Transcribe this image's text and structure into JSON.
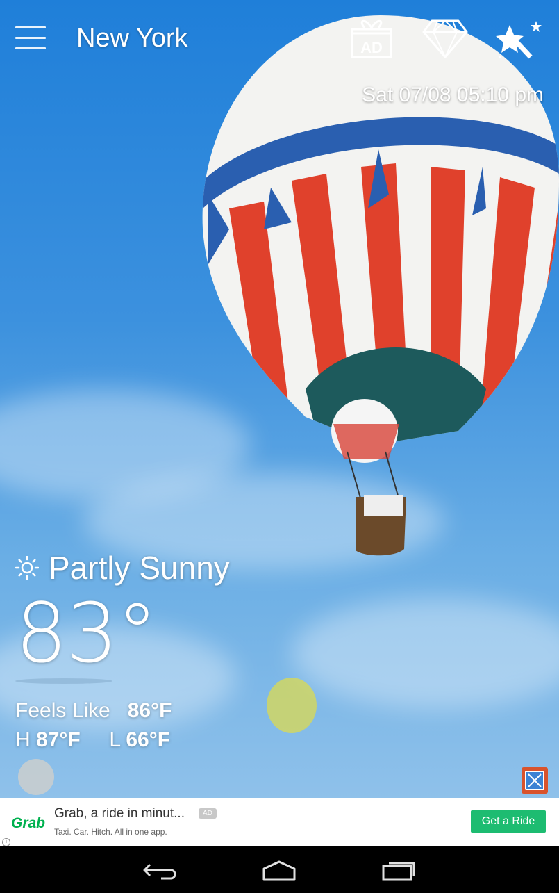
{
  "app": {
    "city": "New York",
    "datetime": "Sat 07/08 05:10 pm"
  },
  "icons": {
    "menu": "hamburger-menu-icon",
    "ad": "ad-gift-icon",
    "premium": "diamond-icon",
    "themes": "magic-wand-icon",
    "ad_icon_text": "AD"
  },
  "weather": {
    "condition_icon": "sun-icon",
    "condition": "Partly Sunny",
    "temperature": "83°",
    "feels_like_label": "Feels Like",
    "feels_like_value": "86°F",
    "high_label": "H",
    "high_value": "87°F",
    "low_label": "L",
    "low_value": "66°F"
  },
  "ad": {
    "brand": "Grab",
    "title": "Grab, a ride in minut...",
    "badge": "AD",
    "subtitle": "Taxi. Car. Hitch. All in one app.",
    "cta": "Get a Ride",
    "adchoices": "i",
    "brand_color": "#00b14f",
    "cta_color": "#1dbc71"
  },
  "navbar": {
    "back": "back-icon",
    "home": "home-icon",
    "recents": "recents-icon"
  }
}
